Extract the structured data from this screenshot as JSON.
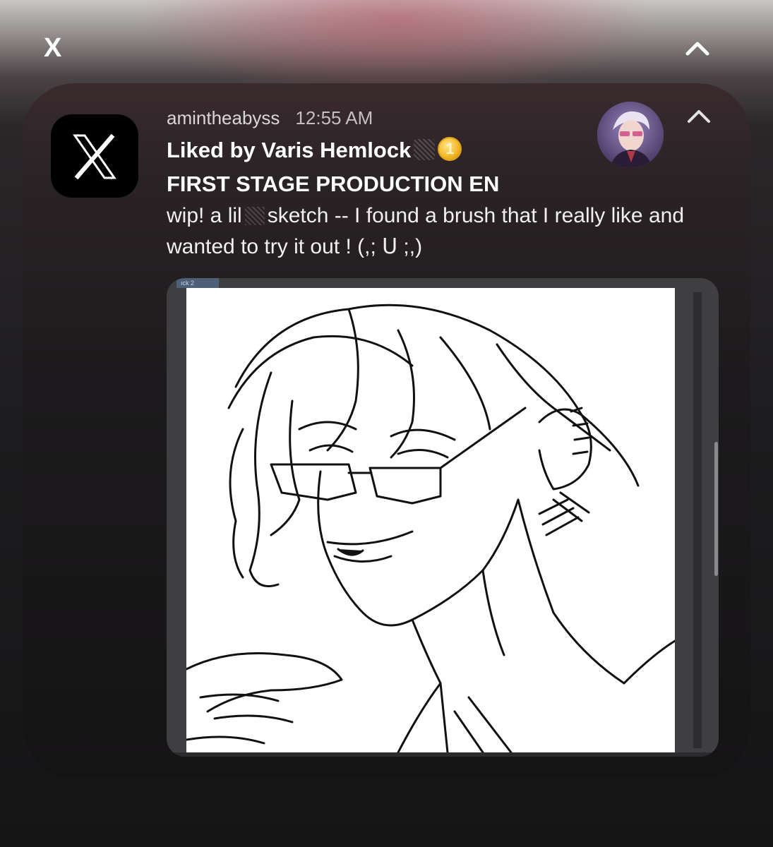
{
  "top_bar": {
    "close_label": "X"
  },
  "notification": {
    "app_icon": "x-logo-icon",
    "username": "amintheabyss",
    "time": "12:55 AM",
    "title": "Liked by Varis Hemlock",
    "title_badge": "1",
    "subtitle": "FIRST STAGE PRODUCTION EN",
    "body_part1": "wip! a lil",
    "body_part2": "sketch -- I found a brush that I really like and wanted to try it out ! (,; ᑌ ;,)",
    "media_tab_label": "ıck 2",
    "avatar": "user-avatar"
  },
  "colors": {
    "accent_coin": "#f2b623",
    "card_background": "#1c1a1c"
  }
}
